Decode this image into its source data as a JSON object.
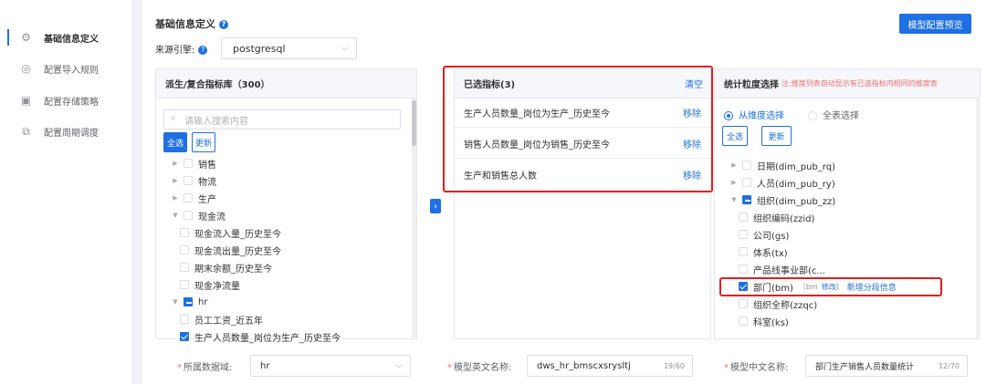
{
  "nav": {
    "items": [
      {
        "label": "基础信息定义",
        "icon": "gear-icon",
        "active": true
      },
      {
        "label": "配置导入规则",
        "icon": "import-rule-icon",
        "active": false
      },
      {
        "label": "配置存储策略",
        "icon": "storage-icon",
        "active": false
      },
      {
        "label": "配置周期调度",
        "icon": "schedule-icon",
        "active": false
      }
    ]
  },
  "header": {
    "title": "基础信息定义",
    "preview_button": "模型配置预览",
    "engine_label": "来源引擎:",
    "engine_value": "postgresql"
  },
  "library": {
    "title": "派生/复合指标库（300）",
    "search_placeholder": "请输入搜索内容",
    "select_all": "全选",
    "refresh": "更新",
    "tree": [
      {
        "label": "销售",
        "level": 0,
        "arrow": "right",
        "state": "none"
      },
      {
        "label": "物流",
        "level": 0,
        "arrow": "right",
        "state": "none"
      },
      {
        "label": "生产",
        "level": 0,
        "arrow": "right",
        "state": "none"
      },
      {
        "label": "现金流",
        "level": 0,
        "arrow": "down",
        "state": "none"
      },
      {
        "label": "现金流入量_历史至今",
        "level": 1,
        "arrow": "",
        "state": "none"
      },
      {
        "label": "现金流出量_历史至今",
        "level": 1,
        "arrow": "",
        "state": "none"
      },
      {
        "label": "期末余额_历史至今",
        "level": 1,
        "arrow": "",
        "state": "none"
      },
      {
        "label": "现金净流量",
        "level": 1,
        "arrow": "",
        "state": "none"
      },
      {
        "label": "hr",
        "level": 0,
        "arrow": "down",
        "state": "indeterminate"
      },
      {
        "label": "员工工资_近五年",
        "level": 1,
        "arrow": "",
        "state": "none"
      },
      {
        "label": "生产人员数量_岗位为生产_历史至今",
        "level": 1,
        "arrow": "",
        "state": "checked"
      }
    ]
  },
  "selected": {
    "title": "已选指标(3)",
    "clear": "清空",
    "items": [
      {
        "label": "生产人员数量_岗位为生产_历史至今",
        "action": "移除"
      },
      {
        "label": "销售人员数量_岗位为销售_历史至今",
        "action": "移除"
      },
      {
        "label": "生产和销售总人数",
        "action": "移除"
      }
    ]
  },
  "granularity": {
    "title": "统计粒度选择",
    "note": "注:维度列表自动显示有已选指标内相同的维度表",
    "radio_dimension": "从维度选择",
    "radio_full": "全表选择",
    "select_all": "全选",
    "refresh": "更新",
    "tree": [
      {
        "label": "日期(dim_pub_rq)",
        "level": 0,
        "arrow": "right",
        "state": "none"
      },
      {
        "label": "人员(dim_pub_ry)",
        "level": 0,
        "arrow": "right",
        "state": "none"
      },
      {
        "label": "组织(dim_pub_zz)",
        "level": 0,
        "arrow": "down",
        "state": "indeterminate"
      },
      {
        "label": "组织编码(zzid)",
        "level": 1,
        "arrow": "",
        "state": "none"
      },
      {
        "label": "公司(gs)",
        "level": 1,
        "arrow": "",
        "state": "none"
      },
      {
        "label": "体系(tx)",
        "level": 1,
        "arrow": "",
        "state": "none"
      },
      {
        "label": "产品线事业部(c...",
        "level": 1,
        "arrow": "",
        "state": "none"
      },
      {
        "label": "部门(bm)",
        "level": 1,
        "arrow": "",
        "state": "checked"
      },
      {
        "label": "组织全称(zzqc)",
        "level": 1,
        "arrow": "",
        "state": "none"
      },
      {
        "label": "科室(ks)",
        "level": 1,
        "arrow": "",
        "state": "none"
      }
    ],
    "dept_code": "（bm",
    "dept_edit": "修改）",
    "dept_new": "新增分段信息"
  },
  "form": {
    "domain_label": "所属数据域:",
    "domain_value": "hr",
    "en_name_label": "模型英文名称:",
    "en_name_value": "dws_hr_bmscxsrysltj",
    "en_name_count": "19/60",
    "cn_name_label": "模型中文名称:",
    "cn_name_value": "部门生产销售人员数量统计",
    "cn_name_count": "12/70"
  },
  "colors": {
    "accent": "#1f6fe5",
    "highlight": "#e02020"
  }
}
